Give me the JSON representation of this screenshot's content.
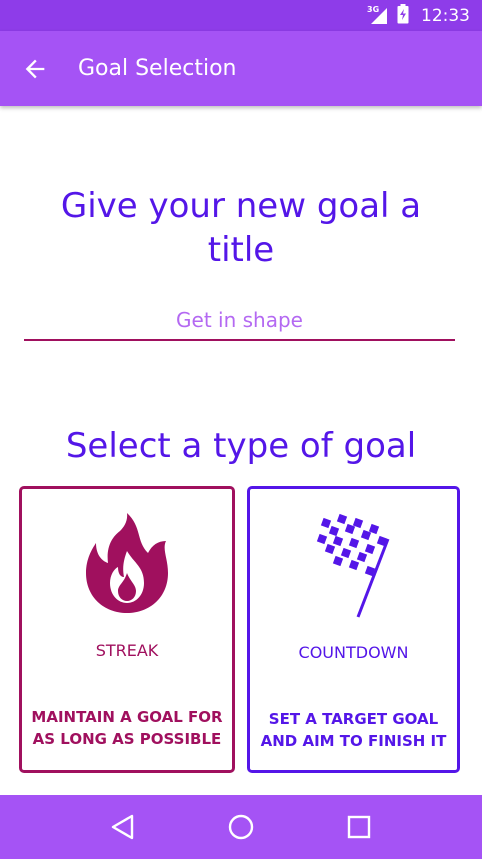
{
  "status_bar": {
    "time": "12:33",
    "network": "3G"
  },
  "app_bar": {
    "title": "Goal Selection"
  },
  "title_section": {
    "heading": "Give your new goal a title",
    "input_placeholder": "Get in shape",
    "input_value": ""
  },
  "type_section": {
    "heading": "Select a type of goal",
    "cards": [
      {
        "label": "STREAK",
        "description": "MAINTAIN A GOAL FOR AS LONG AS POSSIBLE",
        "icon": "flame-icon",
        "color": "#a0105e"
      },
      {
        "label": "COUNTDOWN",
        "description": "SET A TARGET GOAL AND AIM TO FINISH IT",
        "icon": "checkered-flag-icon",
        "color": "#5416e8"
      }
    ]
  },
  "colors": {
    "status_bar": "#8e3ce9",
    "app_bar": "#a553f5",
    "heading": "#5416e8",
    "streak": "#a0105e",
    "countdown": "#5416e8"
  }
}
